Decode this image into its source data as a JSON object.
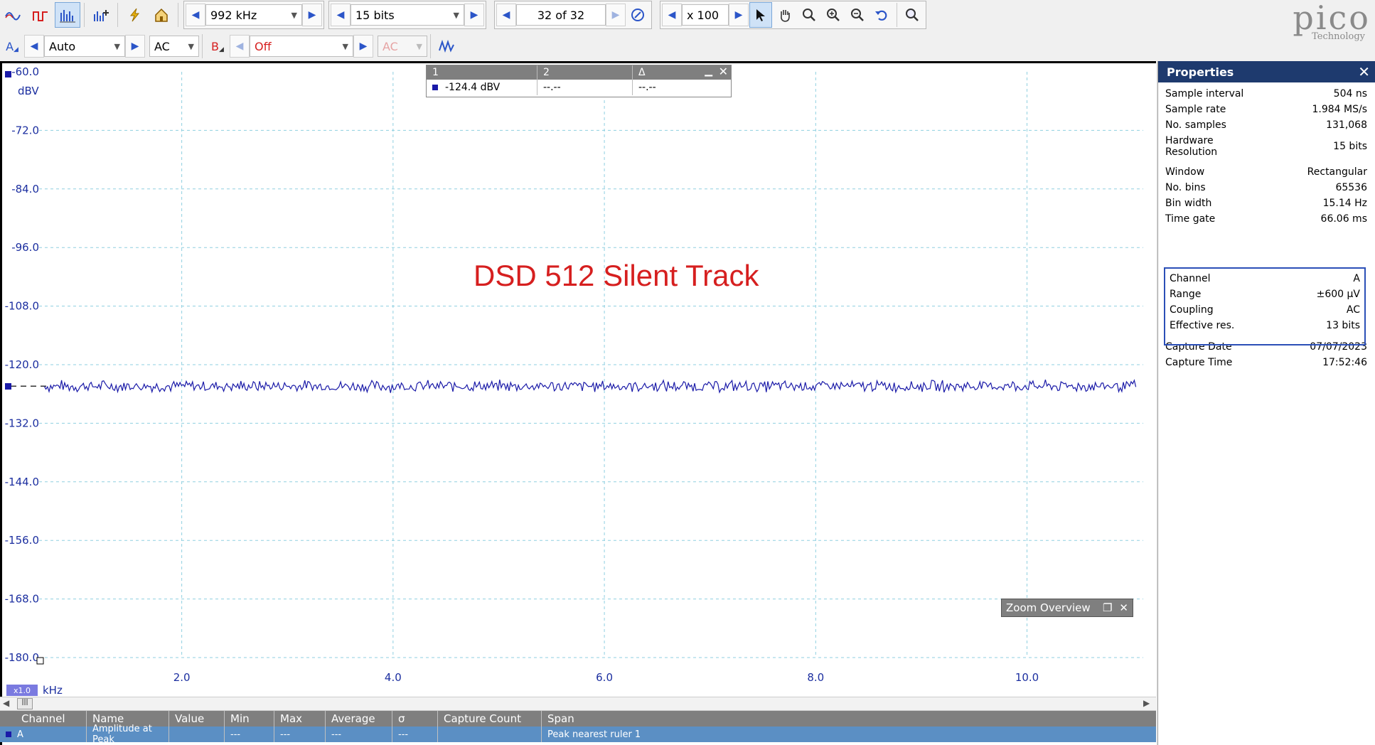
{
  "toolbar1": {
    "timebase": "992 kHz",
    "resolution": "15 bits",
    "buffer": "32 of 32",
    "zoom": "x 100"
  },
  "toolbar2": {
    "channel_a_label": "A",
    "channel_a_range": "Auto",
    "channel_a_coupling": "AC",
    "channel_b_label": "B",
    "channel_b_range": "Off",
    "channel_b_coupling": "AC"
  },
  "logo": {
    "big": "pico",
    "small": "Technology"
  },
  "colors": {
    "trace": "#1a1aa8",
    "axis_text": "#1c2fa0",
    "grid": "#8fcfe0",
    "annotation": "#d61f1f",
    "panel_header": "#1e3a6e"
  },
  "chart_data": {
    "type": "line",
    "ylabel": "dBV",
    "xlabel": "kHz",
    "ylim": [
      -180.0,
      -60.0
    ],
    "xlim": [
      0.65,
      11.1
    ],
    "yticks": [
      "-60.0",
      "-72.0",
      "-84.0",
      "-96.0",
      "-108.0",
      "-120.0",
      "-132.0",
      "-144.0",
      "-156.0",
      "-168.0",
      "-180.0"
    ],
    "xticks": [
      "2.0",
      "4.0",
      "6.0",
      "8.0",
      "10.0"
    ],
    "x_zoom_badge": "x1.0",
    "grid": true,
    "series": [
      {
        "level_dbv": -124.4,
        "noise_span_db": 2.0
      }
    ]
  },
  "annotation": "DSD 512 Silent Track",
  "ruler_table": {
    "headers": [
      "1",
      "2",
      "Δ"
    ],
    "values": [
      "-124.4 dBV",
      "--.--",
      "--.--"
    ]
  },
  "zoom_overview": "Zoom Overview",
  "properties": {
    "title": "Properties",
    "rows": [
      {
        "k": "Sample interval",
        "v": "504 ns"
      },
      {
        "k": "Sample rate",
        "v": "1.984 MS/s"
      },
      {
        "k": "No. samples",
        "v": "131,068"
      },
      {
        "k": "Hardware\nResolution",
        "v": "15 bits"
      },
      {
        "k": "Window",
        "v": "Rectangular"
      },
      {
        "k": "No. bins",
        "v": "65536"
      },
      {
        "k": "Bin width",
        "v": "15.14 Hz"
      },
      {
        "k": "Time gate",
        "v": "66.06 ms"
      }
    ],
    "channel_rows": [
      {
        "k": "Channel",
        "v": "A"
      },
      {
        "k": "Range",
        "v": "±600 µV"
      },
      {
        "k": "Coupling",
        "v": "AC"
      },
      {
        "k": "Effective res.",
        "v": "13 bits"
      }
    ],
    "capture_rows": [
      {
        "k": "Capture Date",
        "v": "07/07/2023"
      },
      {
        "k": "Capture Time",
        "v": "17:52:46"
      }
    ]
  },
  "measurements": {
    "headers": [
      "Channel",
      "Name",
      "Value",
      "Min",
      "Max",
      "Average",
      "σ",
      "Capture Count",
      "Span"
    ],
    "row": [
      "A",
      "Amplitude at Peak",
      "",
      "---",
      "---",
      "---",
      "---",
      "",
      "Peak nearest ruler 1"
    ]
  }
}
